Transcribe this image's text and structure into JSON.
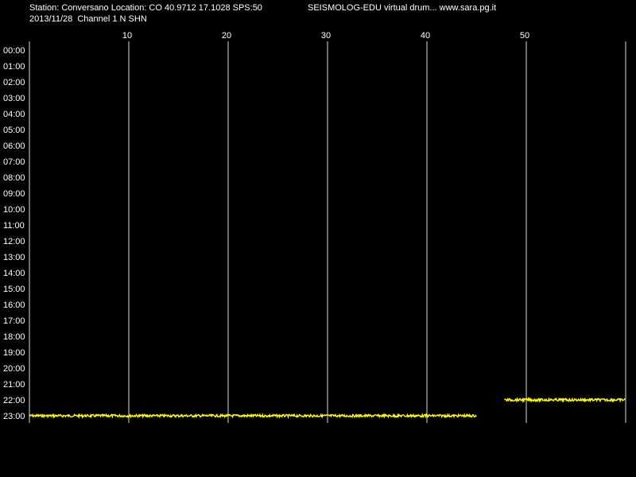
{
  "header": {
    "station_info": "Station: Conversano Location: CO 40.9712 17.1028 SPS:50",
    "date_channel": "2013/11/28  Channel 1 N SHN",
    "site": "SEISMOLOG-EDU virtual drum... www.sara.pg.it"
  },
  "chart_data": {
    "type": "line",
    "title": "",
    "xlabel": "",
    "ylabel": "",
    "x_unit": "minutes",
    "xlim": [
      0,
      60
    ],
    "x_ticks": [
      10,
      20,
      30,
      40,
      50
    ],
    "y_ticks": [
      "00:00",
      "01:00",
      "02:00",
      "03:00",
      "04:00",
      "05:00",
      "06:00",
      "07:00",
      "08:00",
      "09:00",
      "10:00",
      "11:00",
      "12:00",
      "13:00",
      "14:00",
      "15:00",
      "16:00",
      "17:00",
      "18:00",
      "19:00",
      "20:00",
      "21:00",
      "22:00",
      "23:00"
    ],
    "grid": "vertical",
    "background_color": "#000000",
    "grid_color": "#ffffff",
    "trace_color": "#ffff00",
    "series": [
      {
        "hour": "23:00",
        "x_start": 0,
        "x_end": 45
      },
      {
        "hour": "22:00",
        "x_start": 47.8,
        "x_end": 60
      }
    ]
  }
}
